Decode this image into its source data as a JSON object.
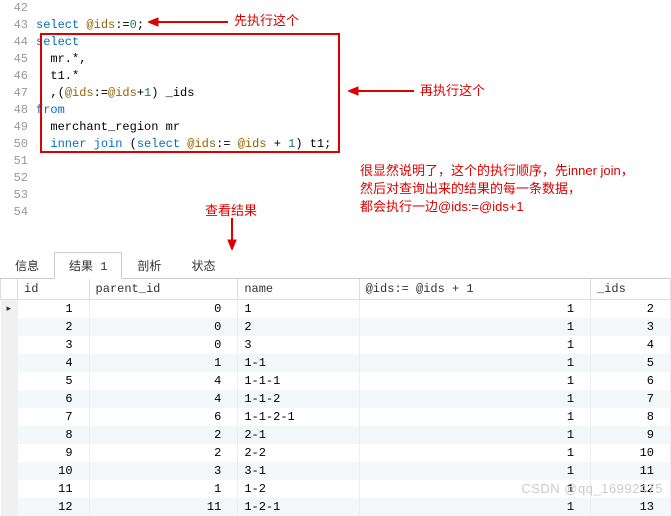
{
  "editor": {
    "line_start": 42,
    "lines": [
      {
        "num": 42,
        "html": ""
      },
      {
        "num": 43,
        "html": "<span class='kw'>select</span> <span class='var'>@ids</span>:=<span class='num'>0</span>;"
      },
      {
        "num": 44,
        "html": "<span class='kw'>select</span>"
      },
      {
        "num": 45,
        "html": "  mr.*,"
      },
      {
        "num": 46,
        "html": "  t1.*"
      },
      {
        "num": 47,
        "html": "  ,(<span class='var'>@ids</span>:=<span class='var'>@ids</span>+<span class='num'>1</span>) _ids"
      },
      {
        "num": 48,
        "html": "<span class='kw'>from</span>"
      },
      {
        "num": 49,
        "html": "  merchant_region mr"
      },
      {
        "num": 50,
        "html": "  <span class='kw'>inner</span> <span class='kw'>join</span> (<span class='kw'>select</span> <span class='var'>@ids</span>:= <span class='var'>@ids</span> + <span class='num'>1</span>) t1;"
      },
      {
        "num": 51,
        "html": ""
      },
      {
        "num": 52,
        "html": ""
      },
      {
        "num": 53,
        "html": ""
      },
      {
        "num": 54,
        "html": ""
      }
    ]
  },
  "annotations": {
    "first": "先执行这个",
    "second": "再执行这个",
    "view_result": "查看结果",
    "explain_line1": "很显然说明了，这个的执行顺序，先inner join，",
    "explain_line2": "然后对查询出来的结果的每一条数据，",
    "explain_line3": "都会执行一边@ids:=@ids+1"
  },
  "tabs": {
    "items": [
      "信息",
      "结果 1",
      "剖析",
      "状态"
    ],
    "active_index": 1
  },
  "grid": {
    "headers": [
      "id",
      "parent_id",
      "name",
      "@ids:= @ids + 1",
      "_ids"
    ],
    "rows": [
      {
        "id": 1,
        "parent_id": 0,
        "name": "1",
        "c4": 1,
        "c5": 2
      },
      {
        "id": 2,
        "parent_id": 0,
        "name": "2",
        "c4": 1,
        "c5": 3
      },
      {
        "id": 3,
        "parent_id": 0,
        "name": "3",
        "c4": 1,
        "c5": 4
      },
      {
        "id": 4,
        "parent_id": 1,
        "name": "1-1",
        "c4": 1,
        "c5": 5
      },
      {
        "id": 5,
        "parent_id": 4,
        "name": "1-1-1",
        "c4": 1,
        "c5": 6
      },
      {
        "id": 6,
        "parent_id": 4,
        "name": "1-1-2",
        "c4": 1,
        "c5": 7
      },
      {
        "id": 7,
        "parent_id": 6,
        "name": "1-1-2-1",
        "c4": 1,
        "c5": 8
      },
      {
        "id": 8,
        "parent_id": 2,
        "name": "2-1",
        "c4": 1,
        "c5": 9
      },
      {
        "id": 9,
        "parent_id": 2,
        "name": "2-2",
        "c4": 1,
        "c5": 10
      },
      {
        "id": 10,
        "parent_id": 3,
        "name": "3-1",
        "c4": 1,
        "c5": 11
      },
      {
        "id": 11,
        "parent_id": 1,
        "name": "1-2",
        "c4": 1,
        "c5": 12
      },
      {
        "id": 12,
        "parent_id": 11,
        "name": "1-2-1",
        "c4": 1,
        "c5": 13
      }
    ]
  },
  "watermark": "CSDN @qq_16992475"
}
